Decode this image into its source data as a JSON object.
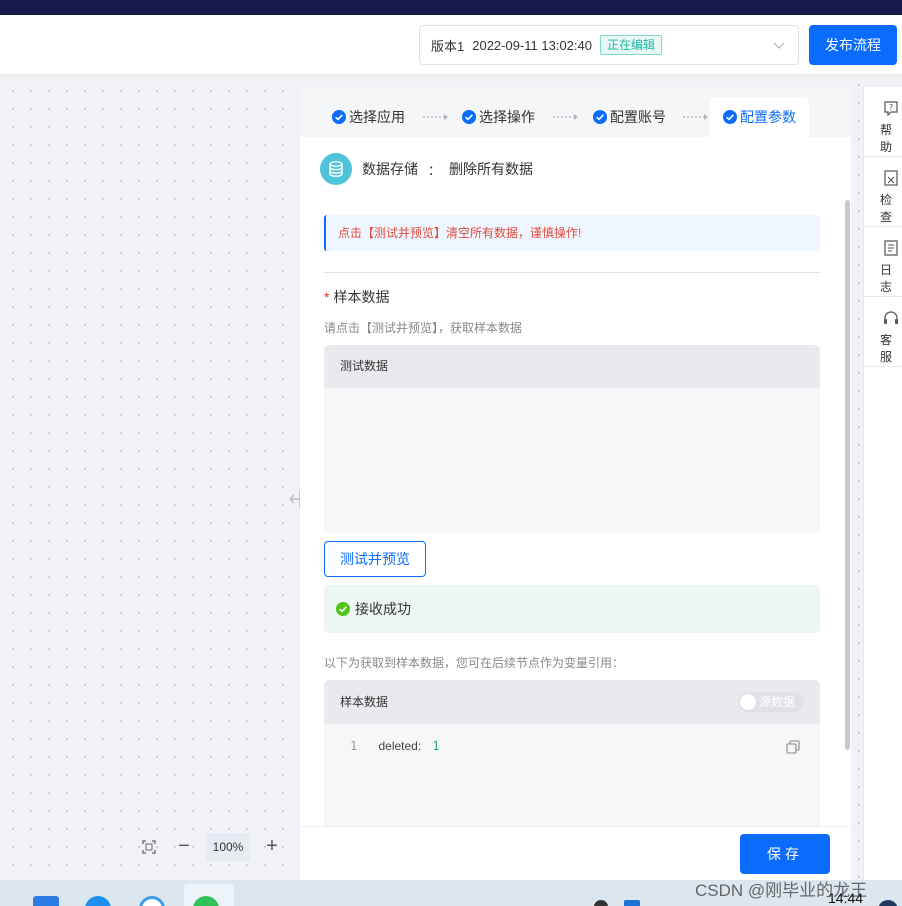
{
  "header": {
    "version_name": "版本1",
    "version_date": "2022-09-11 13:02:40",
    "status_badge": "正在编辑",
    "publish_label": "发布流程"
  },
  "steps": [
    {
      "label": "选择应用",
      "done": true
    },
    {
      "label": "选择操作",
      "done": true
    },
    {
      "label": "配置账号",
      "done": true
    },
    {
      "label": "配置参数",
      "done": true,
      "active": true
    }
  ],
  "app": {
    "name": "数据存储",
    "separator": "：",
    "operation": "删除所有数据",
    "icon": "database-icon"
  },
  "warning": "点击【测试并预览】清空所有数据，谨慎操作!",
  "sample_field": {
    "required_mark": "*",
    "label": "样本数据",
    "hint": "请点击【测试并预览】，获取样本数据"
  },
  "test_box": {
    "title": "测试数据"
  },
  "test_button": "测试并预览",
  "success_message": "接收成功",
  "result_hint": "以下为获取到样本数据，您可在后续节点作为变量引用：",
  "sample_box": {
    "title": "样本数据",
    "toggle_label": "源数据",
    "lines": [
      {
        "line_no": "1",
        "key": "deleted:",
        "value": "1"
      }
    ]
  },
  "zoom": {
    "value": "100%"
  },
  "save_label": "保存",
  "right_sidebar": [
    {
      "label": "帮助",
      "icon": "help-icon"
    },
    {
      "label": "检查",
      "icon": "check-doc-icon"
    },
    {
      "label": "日志",
      "icon": "log-icon"
    },
    {
      "label": "客服",
      "icon": "headset-icon"
    }
  ],
  "taskbar": {
    "watermark": "CSDN @刚毕业的龙王",
    "clock": "14:44"
  },
  "colors": {
    "primary": "#0a6cff",
    "warning_text": "#e14b3b",
    "success_bg": "#edf7f2",
    "badge": "#1db8a6"
  }
}
